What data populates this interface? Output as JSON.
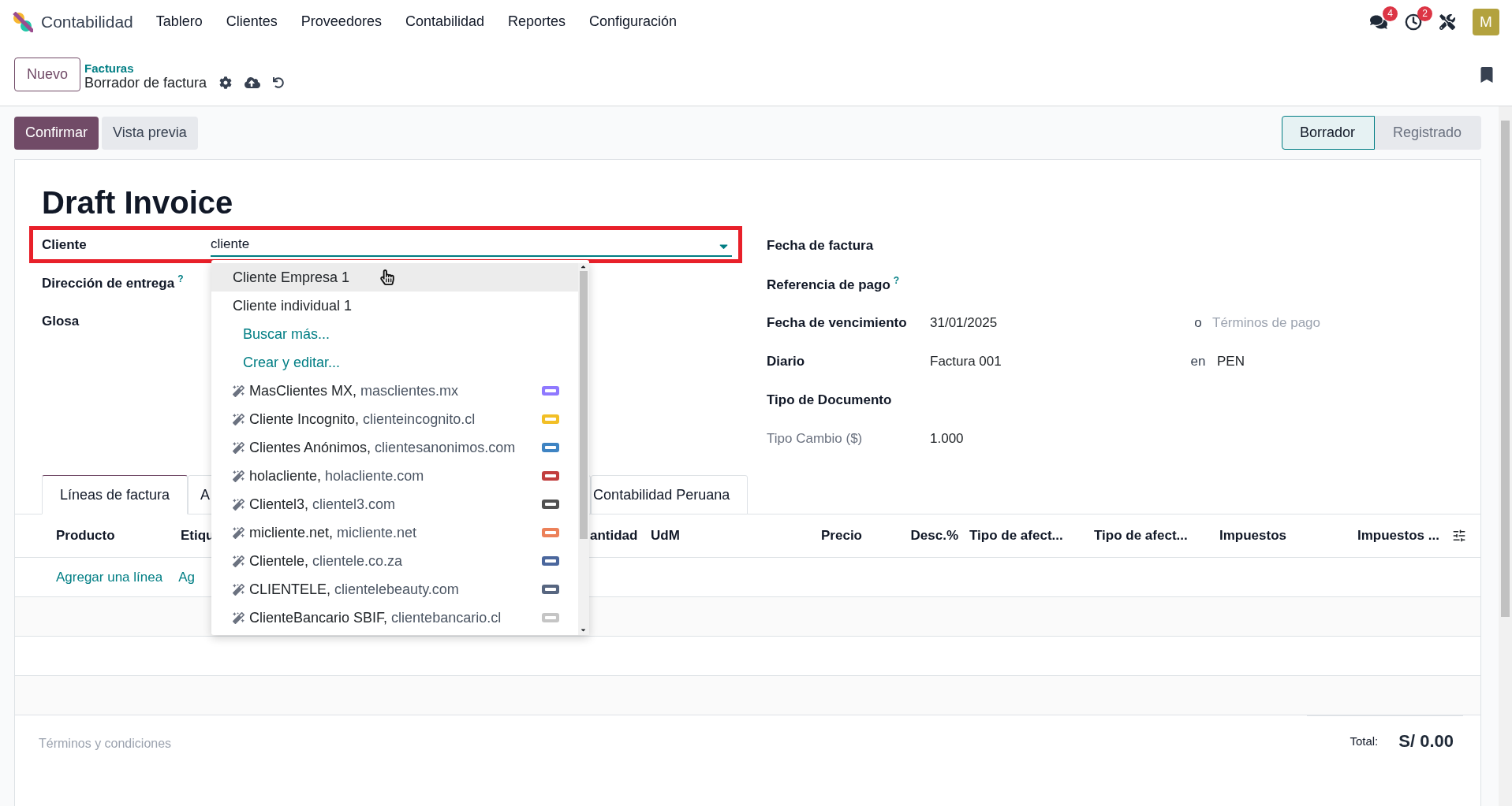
{
  "app": {
    "name": "Contabilidad"
  },
  "menu": [
    "Tablero",
    "Clientes",
    "Proveedores",
    "Contabilidad",
    "Reportes",
    "Configuración"
  ],
  "systray": [
    {
      "kind": "chat",
      "badge": "4"
    },
    {
      "kind": "activity",
      "badge": "2"
    },
    {
      "kind": "tools"
    },
    {
      "kind": "avatar",
      "initial": "M"
    }
  ],
  "control_panel": {
    "new_button": "Nuevo",
    "breadcrumb": "Facturas",
    "record_title": "Borrador de factura"
  },
  "actions": [
    {
      "label": "Confirmar",
      "primary": true
    },
    {
      "label": "Vista previa",
      "primary": false
    }
  ],
  "status_stages": [
    {
      "label": "Borrador",
      "selected": true
    },
    {
      "label": "Registrado",
      "selected": false
    }
  ],
  "title": "Draft Invoice",
  "left_fields": [
    {
      "label": "Cliente",
      "value": "cliente",
      "highlighted": true
    },
    {
      "label": "Dirección de entrega",
      "help": "?",
      "highlighted": false
    },
    {
      "label": "Glosa",
      "highlighted": false
    }
  ],
  "autocomplete": [
    {
      "kind": "record",
      "name": "Cliente Empresa 1",
      "selected": true
    },
    {
      "kind": "record",
      "name": "Cliente individual 1",
      "selected": false
    },
    {
      "kind": "action",
      "name": "Buscar más...",
      "selected": false
    },
    {
      "kind": "action",
      "name": "Crear y editar...",
      "selected": false
    },
    {
      "kind": "suggestion",
      "name": "MasClientes MX,",
      "domain": "masclientes.mx",
      "selected": false
    },
    {
      "kind": "suggestion",
      "name": "Cliente Incognito,",
      "domain": "clienteincognito.cl",
      "selected": false
    },
    {
      "kind": "suggestion",
      "name": "Clientes Anónimos,",
      "domain": "clientesanonimos.com",
      "selected": false
    },
    {
      "kind": "suggestion",
      "name": "holacliente,",
      "domain": "holacliente.com",
      "selected": false
    },
    {
      "kind": "suggestion",
      "name": "Clientel3,",
      "domain": "clientel3.com",
      "selected": false
    },
    {
      "kind": "suggestion",
      "name": "micliente.net,",
      "domain": "micliente.net",
      "selected": false
    },
    {
      "kind": "suggestion",
      "name": "Clientele,",
      "domain": "clientele.co.za",
      "selected": false
    },
    {
      "kind": "suggestion",
      "name": "CLIENTELE,",
      "domain": "clientelebeauty.com",
      "selected": false
    },
    {
      "kind": "suggestion",
      "name": "ClienteBancario SBIF,",
      "domain": "clientebancario.cl",
      "selected": false
    }
  ],
  "right_fields": [
    {
      "label": "Fecha de factura",
      "muted": false
    },
    {
      "label": "Referencia de pago",
      "help": "?",
      "muted": false
    },
    {
      "label": "Fecha de vencimiento",
      "value": "31/01/2025",
      "separator": "o",
      "extra_placeholder": "Términos de pago",
      "muted": false
    },
    {
      "label": "Diario",
      "value": "Factura 001",
      "separator": "en",
      "extra_value": "PEN",
      "muted": false
    },
    {
      "label": "Tipo de Documento",
      "muted": false
    },
    {
      "label": "Tipo Cambio ($)",
      "value": "1.000",
      "muted": true
    }
  ],
  "tabs": [
    {
      "label": "Líneas de factura",
      "selected": true
    },
    {
      "label": "A",
      "selected": false
    },
    {
      "label": "Contabilidad Peruana",
      "selected": false
    }
  ],
  "table": {
    "columns": [
      "Producto",
      "Etiqu",
      "antidad",
      "UdM",
      "Precio",
      "Desc.%",
      "Tipo de afect...",
      "Tipo de afect...",
      "Impuestos",
      "Impuestos ..."
    ],
    "add_links": [
      "Agregar una línea",
      "Ag"
    ]
  },
  "footer": {
    "terms_placeholder": "Términos y condiciones",
    "total_label": "Total:",
    "total_value": "S/ 0.00"
  }
}
